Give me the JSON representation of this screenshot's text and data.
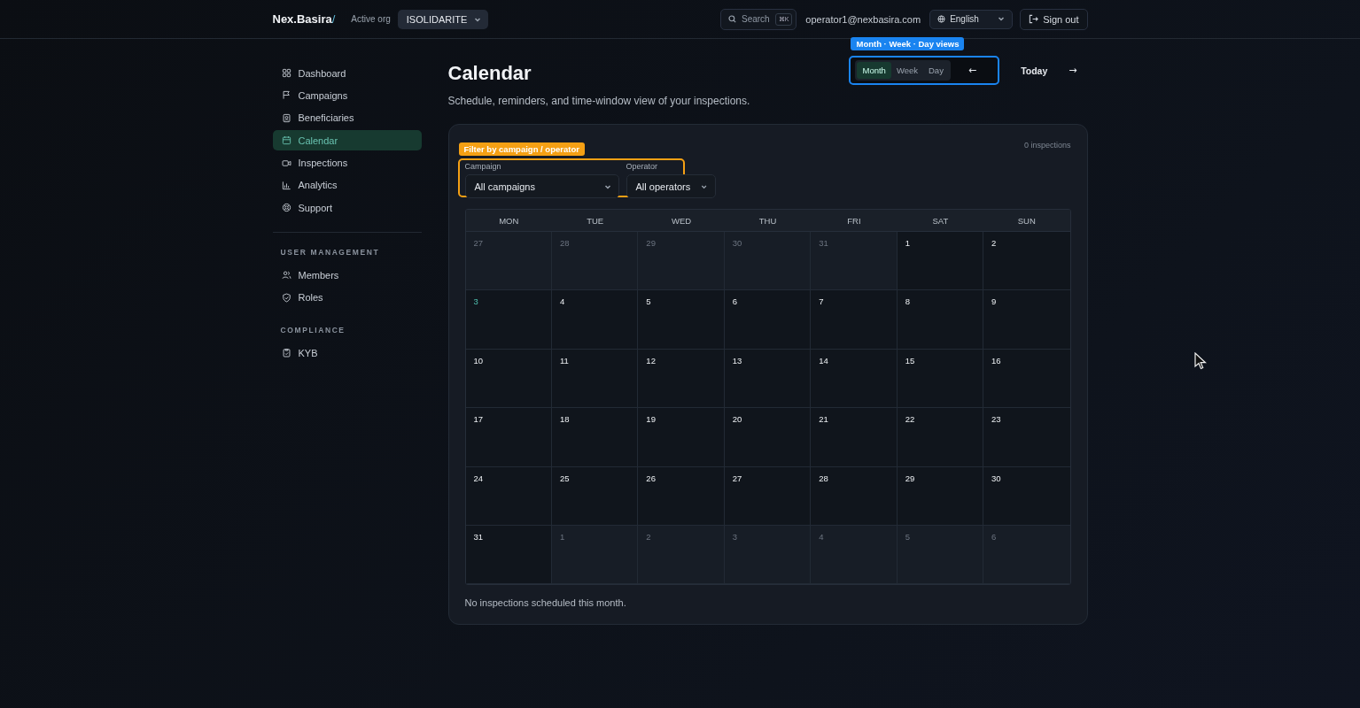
{
  "header": {
    "brand": "Nex.Basira",
    "brand_mark": "/",
    "org_label": "Active org",
    "org_value": "ISOLIDARITE",
    "search": {
      "placeholder": "Search",
      "shortcut": "⌘K"
    },
    "user_email": "operator1@nexbasira.com",
    "language": "English",
    "sign_out": "Sign out"
  },
  "sidebar": {
    "items": [
      {
        "label": "Dashboard",
        "selected": false
      },
      {
        "label": "Campaigns",
        "selected": false
      },
      {
        "label": "Beneficiaries",
        "selected": false
      },
      {
        "label": "Calendar",
        "selected": true
      },
      {
        "label": "Inspections",
        "selected": false
      },
      {
        "label": "Analytics",
        "selected": false
      },
      {
        "label": "Support",
        "selected": false
      }
    ],
    "sections": [
      {
        "title": "USER MANAGEMENT",
        "items": [
          {
            "label": "Members",
            "selected": false
          },
          {
            "label": "Roles",
            "selected": false
          }
        ]
      },
      {
        "title": "COMPLIANCE",
        "items": [
          {
            "label": "KYB",
            "selected": false
          }
        ]
      }
    ]
  },
  "page": {
    "title": "Calendar",
    "subtitle": "Schedule, reminders, and time-window view of your inspections.",
    "view_tabs": [
      {
        "label": "Month",
        "selected": true
      },
      {
        "label": "Week",
        "selected": false
      },
      {
        "label": "Day",
        "selected": false
      }
    ],
    "prev": "←",
    "today": "Today",
    "next": "→",
    "callouts": [
      {
        "label": "Month · Week · Day views",
        "color": "#1a84f0"
      },
      {
        "label": "Filter by campaign / operator",
        "color": "#f5a014"
      }
    ]
  },
  "calendar": {
    "count": "0 inspections",
    "filters": [
      {
        "label": "Campaign",
        "value": "All campaigns"
      },
      {
        "label": "Operator",
        "value": "All operators"
      }
    ],
    "weekdays": [
      "MON",
      "TUE",
      "WED",
      "THU",
      "FRI",
      "SAT",
      "SUN"
    ],
    "weeks": [
      [
        {
          "day": "27",
          "in_month": false,
          "today": false
        },
        {
          "day": "28",
          "in_month": false,
          "today": false
        },
        {
          "day": "29",
          "in_month": false,
          "today": false
        },
        {
          "day": "30",
          "in_month": false,
          "today": false
        },
        {
          "day": "31",
          "in_month": false,
          "today": false
        },
        {
          "day": "1",
          "in_month": true,
          "today": false
        },
        {
          "day": "2",
          "in_month": true,
          "today": false
        }
      ],
      [
        {
          "day": "3",
          "in_month": true,
          "today": true
        },
        {
          "day": "4",
          "in_month": true,
          "today": false
        },
        {
          "day": "5",
          "in_month": true,
          "today": false
        },
        {
          "day": "6",
          "in_month": true,
          "today": false
        },
        {
          "day": "7",
          "in_month": true,
          "today": false
        },
        {
          "day": "8",
          "in_month": true,
          "today": false
        },
        {
          "day": "9",
          "in_month": true,
          "today": false
        }
      ],
      [
        {
          "day": "10",
          "in_month": true,
          "today": false
        },
        {
          "day": "11",
          "in_month": true,
          "today": false
        },
        {
          "day": "12",
          "in_month": true,
          "today": false
        },
        {
          "day": "13",
          "in_month": true,
          "today": false
        },
        {
          "day": "14",
          "in_month": true,
          "today": false
        },
        {
          "day": "15",
          "in_month": true,
          "today": false
        },
        {
          "day": "16",
          "in_month": true,
          "today": false
        }
      ],
      [
        {
          "day": "17",
          "in_month": true,
          "today": false
        },
        {
          "day": "18",
          "in_month": true,
          "today": false
        },
        {
          "day": "19",
          "in_month": true,
          "today": false
        },
        {
          "day": "20",
          "in_month": true,
          "today": false
        },
        {
          "day": "21",
          "in_month": true,
          "today": false
        },
        {
          "day": "22",
          "in_month": true,
          "today": false
        },
        {
          "day": "23",
          "in_month": true,
          "today": false
        }
      ],
      [
        {
          "day": "24",
          "in_month": true,
          "today": false
        },
        {
          "day": "25",
          "in_month": true,
          "today": false
        },
        {
          "day": "26",
          "in_month": true,
          "today": false
        },
        {
          "day": "27",
          "in_month": true,
          "today": false
        },
        {
          "day": "28",
          "in_month": true,
          "today": false
        },
        {
          "day": "29",
          "in_month": true,
          "today": false
        },
        {
          "day": "30",
          "in_month": true,
          "today": false
        }
      ],
      [
        {
          "day": "31",
          "in_month": true,
          "today": false
        },
        {
          "day": "1",
          "in_month": false,
          "today": false
        },
        {
          "day": "2",
          "in_month": false,
          "today": false
        },
        {
          "day": "3",
          "in_month": false,
          "today": false
        },
        {
          "day": "4",
          "in_month": false,
          "today": false
        },
        {
          "day": "5",
          "in_month": false,
          "today": false
        },
        {
          "day": "6",
          "in_month": false,
          "today": false
        }
      ]
    ],
    "empty_note": "No inspections scheduled this month."
  }
}
